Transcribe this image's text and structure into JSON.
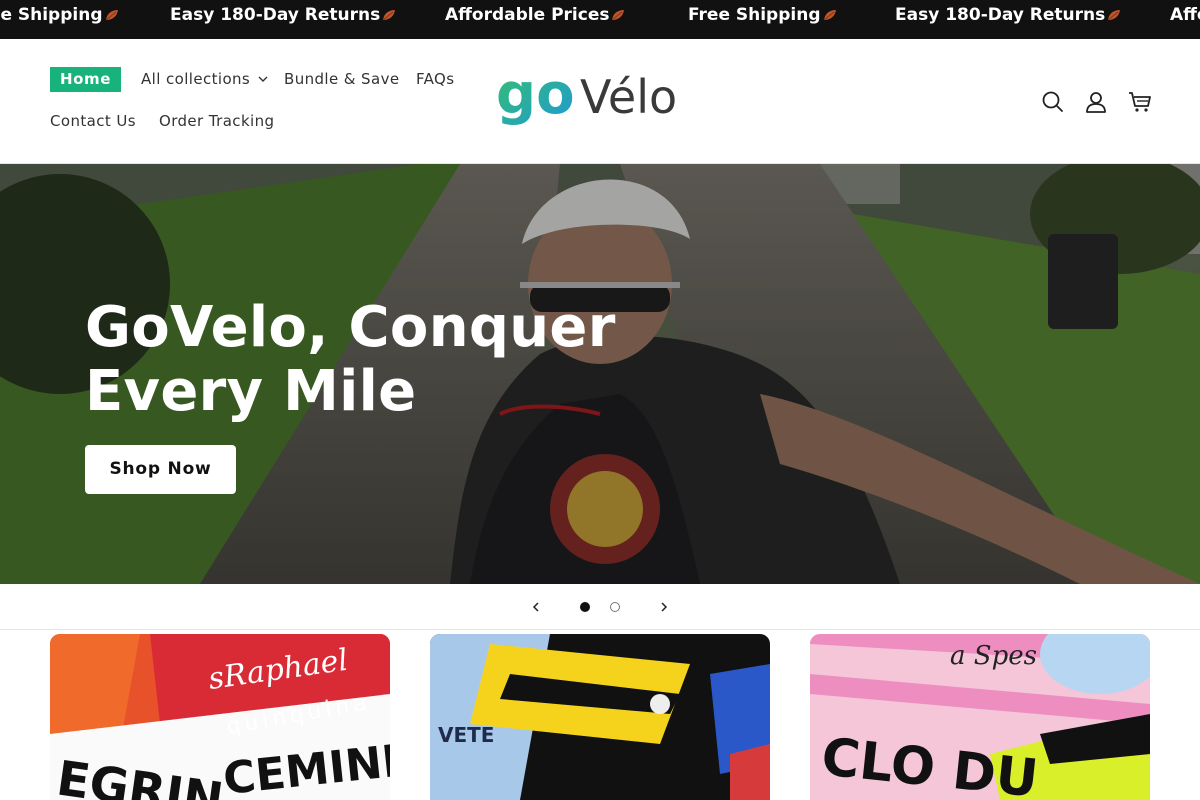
{
  "announcement": {
    "items": [
      "Free Shipping",
      "Easy 180-Day Returns",
      "Affordable Prices",
      "Free Shipping",
      "Easy 180-Day Returns",
      "Affordable Prices"
    ],
    "icon": "autumn-leaf-icon"
  },
  "nav": {
    "home": "Home",
    "all_collections": "All collections",
    "bundle": "Bundle & Save",
    "faqs": "FAQs",
    "contact": "Contact Us",
    "order_tracking": "Order Tracking"
  },
  "logo": {
    "text_go": "go",
    "text_velo": "Vélo"
  },
  "header_icons": [
    "search-icon",
    "account-icon",
    "cart-icon"
  ],
  "hero": {
    "title_line1": "GoVelo, Conquer",
    "title_line2": "Every Mile",
    "cta": "Shop Now"
  },
  "slider": {
    "slide_count": 2,
    "active_index": 0
  },
  "colors": {
    "announcement_bg": "#111111",
    "accent_green": "#18b37c",
    "logo_gradient_start": "#36c06b",
    "logo_gradient_end": "#1e9ad6",
    "logo_dark": "#3a3a3a"
  }
}
